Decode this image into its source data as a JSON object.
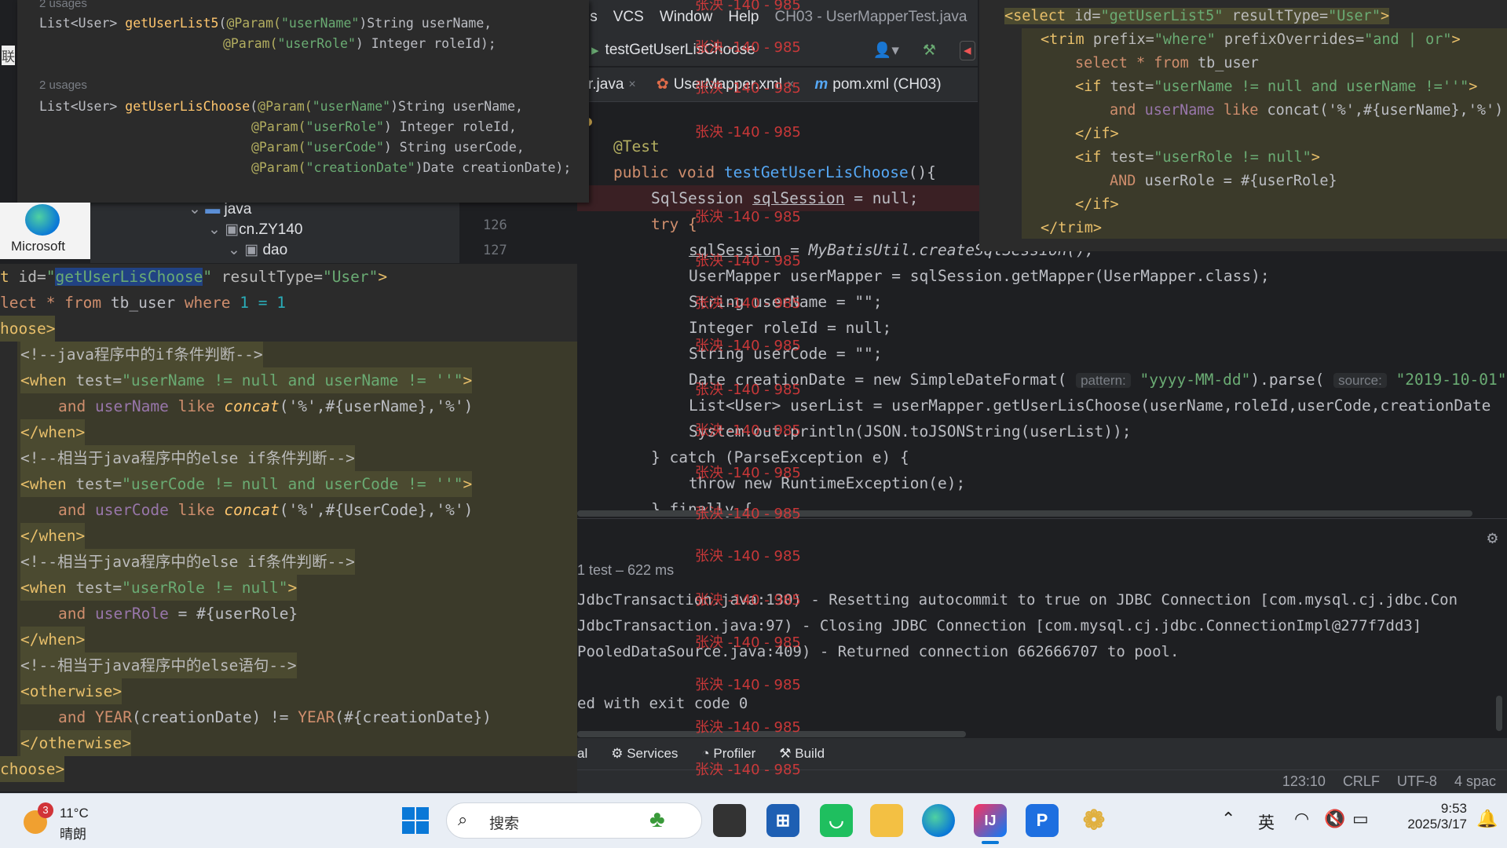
{
  "menubar": {
    "items": [
      "ls",
      "VCS",
      "Window",
      "Help"
    ],
    "title": "CH03 - UserMapperTest.java"
  },
  "runbar": {
    "config": "testGetUserLisChoose"
  },
  "tabs": [
    {
      "label": "r.java",
      "close": "×"
    },
    {
      "label": "UserMapper.xml",
      "close": "×"
    },
    {
      "label": "pom.xml (CH03)",
      "close": ""
    }
  ],
  "project_tree": {
    "items": [
      "java",
      "cn.ZY140",
      "dao"
    ],
    "gutter": [
      "126",
      "127"
    ]
  },
  "editor": {
    "annotation": "@Test",
    "signature": {
      "kw1": "public void",
      "name": "testGetUserLisChoose",
      "rest": "(){"
    },
    "l_session": {
      "type": "SqlSession ",
      "var": "sqlSession",
      "rest": " = null;"
    },
    "l_try": "try {",
    "l_create": {
      "var": "sqlSession",
      "rest": " = MyBatisUtil.createSqlSession();"
    },
    "l_mapper": "UserMapper userMapper = sqlSession.getMapper(UserMapper.class);",
    "l_username": "String userName = \"\";",
    "l_roleid": "Integer roleId = null;",
    "l_usercode": "String userCode = \"\";",
    "l_date": {
      "pre": "Date creationDate = new SimpleDateFormat(",
      "hint1": "pattern:",
      "str1": "\"yyyy-MM-dd\"",
      "mid": ").parse(",
      "hint2": "source:",
      "str2": "\"2019-10-01\""
    },
    "l_list": "List<User> userList = userMapper.getUserLisChoose(userName,roleId,userCode,creationDate",
    "l_print": "System.out.println(JSON.toJSONString(userList));",
    "l_catch": "} catch (ParseException e) {",
    "l_throw": "throw new RuntimeException(e);",
    "l_finally": "} finally {"
  },
  "console": {
    "header": "1 test – 622 ms",
    "lines": [
      "JdbcTransaction.java:130) - Resetting autocommit to true on JDBC Connection [com.mysql.cj.jdbc.Con",
      "JdbcTransaction.java:97) - Closing JDBC Connection [com.mysql.cj.jdbc.ConnectionImpl@277f7dd3]",
      "PooledDataSource.java:409) - Returned connection 662666707 to pool.",
      "",
      "ed with exit code 0"
    ]
  },
  "toolwindows": [
    "al",
    "Services",
    "Profiler",
    "Build"
  ],
  "statusbar": [
    "123:10",
    "CRLF",
    "UTF-8",
    "4 spac"
  ],
  "snippet_top_left": {
    "usages1": "2 usages",
    "m1_line1": {
      "type": "List<User> ",
      "name": "getUserList5",
      "ann": "@Param(",
      "str": "\"userName\"",
      "rest": ")String userName,"
    },
    "m1_line2": {
      "ann": "@Param(",
      "str": "\"userRole\"",
      "rest": ") Integer roleId);"
    },
    "usages2": "2 usages",
    "m2_line1": {
      "type": "List<User> ",
      "name": "getUserLisChoose",
      "ann": "@Param(",
      "str": "\"userName\"",
      "rest": ")String userName,"
    },
    "m2_line2": {
      "ann": "@Param(",
      "str": "\"userRole\"",
      "rest": ") Integer roleId,"
    },
    "m2_line3": {
      "ann": "@Param(",
      "str": "\"userCode\"",
      "rest": ") String userCode,"
    },
    "m2_line4": {
      "ann": "@Param(",
      "str": "\"creationDate\"",
      "rest": ")Date creationDate);"
    }
  },
  "snippet_top_right": {
    "l1": {
      "open": "<select ",
      "a1": "id=",
      "v1": "\"getUserList5\"",
      "a2": " resultType=",
      "v2": "\"User\"",
      "close": ">"
    },
    "l2": {
      "open": "<trim ",
      "a1": "prefix=",
      "v1": "\"where\"",
      "a2": " prefixOverrides=",
      "v2": "\"and | or\"",
      "close": ">"
    },
    "l3": {
      "kw": "select * from ",
      "rest": "tb_user"
    },
    "l4": {
      "open": "<if ",
      "a1": "test=",
      "v1": "\"userName != null and userName !=''\"",
      "close": ">"
    },
    "l5": {
      "kw": "and ",
      "col": "userName ",
      "kw2": "like ",
      "rest": "concat('%',#{userName},'%')"
    },
    "l6": "</if>",
    "l7": {
      "open": "<if ",
      "a1": "test=",
      "v1": "\"userRole != null\"",
      "close": ">"
    },
    "l8": {
      "kw": "AND ",
      "rest": "userRole = #{userRole}"
    },
    "l9": "</if>",
    "l10": "</trim>"
  },
  "snippet_bottom_left": {
    "l1": {
      "pre": "t ",
      "a1": "id=",
      "q": "\"",
      "sel": "getUserLisChoose",
      "q2": "\"",
      "a2": " resultType=",
      "v2": "\"User\"",
      "close": ">"
    },
    "l2": {
      "kw": "lect * from ",
      "tbl": "tb_user ",
      "kw2": "where ",
      "num": "1 = 1"
    },
    "l3": "hoose>",
    "c1": "<!--java程序中的if条件判断-->",
    "w1": {
      "open": "<when ",
      "a": "test=",
      "v": "\"userName != null and userName != ''\"",
      "close": ">"
    },
    "w1b": {
      "kw": "and ",
      "col": "userName ",
      "kw2": "like ",
      "fn": "concat",
      "rest": "('%',#{userName},'%')"
    },
    "w1c": "</when>",
    "c2": "<!--相当于java程序中的else if条件判断-->",
    "w2": {
      "open": "<when ",
      "a": "test=",
      "v": "\"userCode != null and userCode != ''\"",
      "close": ">"
    },
    "w2b": {
      "kw": "and ",
      "col": "userCode ",
      "kw2": "like ",
      "fn": "concat",
      "rest": "('%',#{UserCode},'%')"
    },
    "w2c": "</when>",
    "c3": "<!--相当于java程序中的else if条件判断-->",
    "w3": {
      "open": "<when ",
      "a": "test=",
      "v": "\"userRole != null\"",
      "close": ">"
    },
    "w3b": {
      "kw": "and ",
      "col": "userRole ",
      "rest": "= #{userRole}"
    },
    "w3c": "</when>",
    "c4": "<!--相当于java程序中的else语句-->",
    "o1": "<otherwise>",
    "o2": {
      "kw": "and ",
      "fn": "YEAR",
      "rest": "(creationDate) != ",
      "fn2": "YEAR",
      "rest2": "(#{creationDate})"
    },
    "o3": "</otherwise>",
    "end": "choose>"
  },
  "desktop": {
    "edge_label": "Microsoft",
    "left_glyph": "联"
  },
  "watermark": "张泱 -140 - 985",
  "taskbar": {
    "weather_temp": "11°C",
    "weather_desc": "晴朗",
    "weather_badge": "3",
    "search_placeholder": "搜索",
    "ime": "英",
    "time": "9:53",
    "date": "2025/3/17"
  },
  "colors": {
    "ide_bg": "#1e1f22",
    "panel_bg": "#2b2d30",
    "taskbar_bg": "#e9eef5",
    "xml_highlight": "#4b4a30",
    "watermark": "#e63c3c"
  }
}
